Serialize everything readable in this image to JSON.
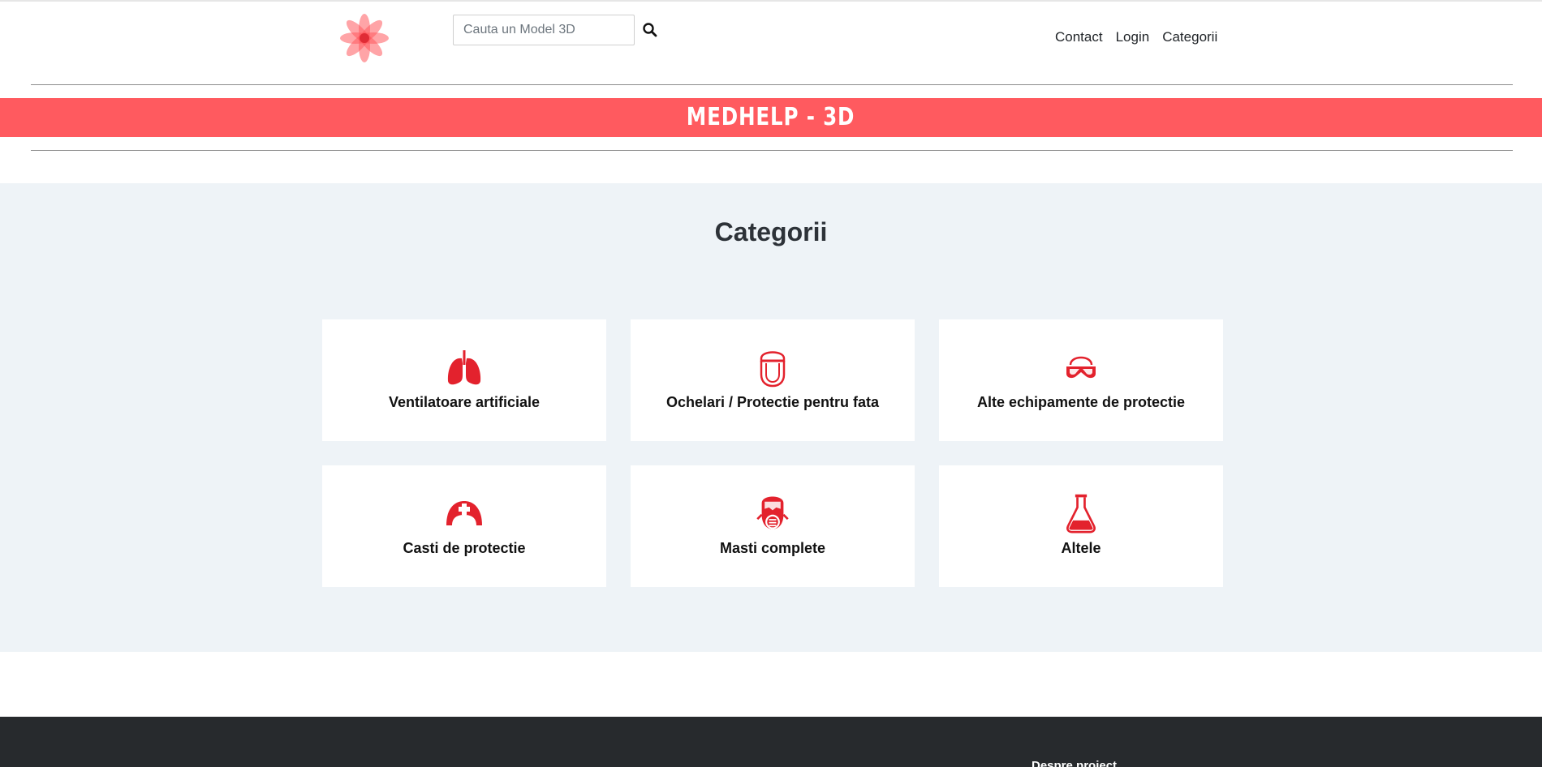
{
  "header": {
    "logo_icon": "flower-logo-icon",
    "search": {
      "placeholder": "Cauta un Model 3D",
      "value": ""
    },
    "search_icon": "search-icon",
    "nav": [
      "Contact",
      "Login",
      "Categorii"
    ]
  },
  "banner": {
    "title": "MEDHELP - 3D"
  },
  "categories": {
    "title": "Categorii",
    "items": [
      {
        "label": "Ventilatoare artificiale",
        "icon": "lungs-icon"
      },
      {
        "label": "Ochelari / Protectie pentru fata",
        "icon": "face-shield-icon"
      },
      {
        "label": "Alte echipamente de protectie",
        "icon": "goggles-icon"
      },
      {
        "label": "Casti de protectie",
        "icon": "nurse-cap-icon"
      },
      {
        "label": "Masti complete",
        "icon": "respirator-mask-icon"
      },
      {
        "label": "Altele",
        "icon": "flask-icon"
      }
    ]
  },
  "footer": {
    "about": "Despre proiect"
  },
  "colors": {
    "accent": "#ff5a5f",
    "icon_red": "#e3222d",
    "section_bg": "#eef3f7",
    "footer_bg": "#272a2d"
  }
}
